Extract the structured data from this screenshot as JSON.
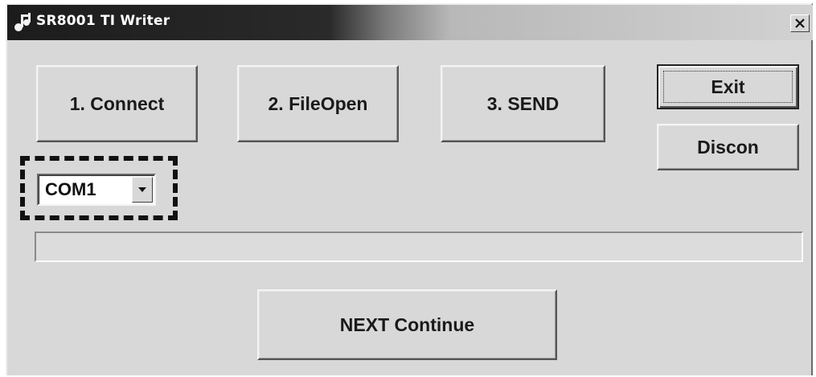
{
  "window": {
    "title": "SR8001 TI Writer",
    "app_icon": "app-icon",
    "close_label": "×",
    "close_icon": "close-icon"
  },
  "buttons": {
    "connect": "1. Connect",
    "file_open": "2. FileOpen",
    "send": "3. SEND",
    "exit": "Exit",
    "disconnect": "Discon",
    "next_continue": "NEXT Continue"
  },
  "port_select": {
    "value": "COM1",
    "arrow_icon": "dropdown-arrow-icon"
  },
  "progress": {
    "fraction": 0
  },
  "colors": {
    "dialog_face": "#d8d8d8",
    "titlebar_dark": "#1c1c1c",
    "titlebar_light": "#d2d2d2",
    "progress_fill": "#1c3f94"
  }
}
